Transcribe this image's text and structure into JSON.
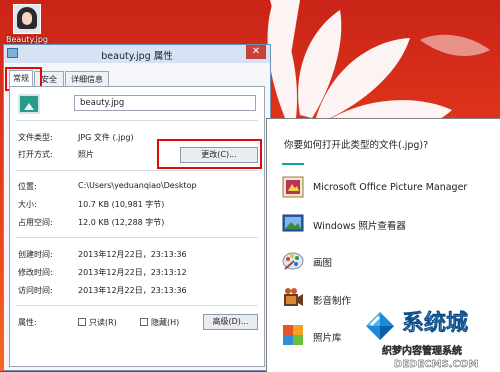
{
  "desktop": {
    "icon_label": "Beauty.jpg"
  },
  "window": {
    "title": "beauty.jpg 属性",
    "close_glyph": "✕",
    "tabs": [
      "常规",
      "安全",
      "详细信息"
    ],
    "filename": "beauty.jpg",
    "fields": {
      "file_type_label": "文件类型:",
      "file_type": "JPG 文件 (.jpg)",
      "opens_with_label": "打开方式:",
      "opens_with": "照片",
      "change_button": "更改(C)...",
      "location_label": "位置:",
      "location": "C:\\Users\\yeduanqiao\\Desktop",
      "size_label": "大小:",
      "size": "10.7 KB (10,981 字节)",
      "size_on_disk_label": "占用空间:",
      "size_on_disk": "12.0 KB (12,288 字节)",
      "created_label": "创建时间:",
      "created": "2013年12月22日，23:13:36",
      "modified_label": "修改时间:",
      "modified": "2013年12月22日，23:13:12",
      "accessed_label": "访问时间:",
      "accessed": "2013年12月22日，23:13:36",
      "attributes_label": "属性:",
      "readonly_label": "只读(R)",
      "hidden_label": "隐藏(H)",
      "advanced_button": "高级(D)..."
    }
  },
  "open_with": {
    "heading": "你要如何打开此类型的文件(.jpg)?",
    "accent_color": "#16a3a0",
    "apps": [
      {
        "name": "Microsoft Office Picture Manager",
        "icon": "picture-manager-icon"
      },
      {
        "name": "Windows 照片查看器",
        "icon": "photo-viewer-icon"
      },
      {
        "name": "画图",
        "icon": "paint-icon"
      },
      {
        "name": "影音制作",
        "icon": "movie-maker-icon"
      },
      {
        "name": "照片库",
        "icon": "photo-gallery-icon"
      }
    ]
  },
  "watermark": {
    "brand": "系统城",
    "site": "xitongcheng.com",
    "caption": "织梦内容管理系统",
    "domain": "DEDECMS.COM"
  },
  "colors": {
    "highlight_red": "#e00a0a",
    "desktop_red": "#e0351b"
  }
}
